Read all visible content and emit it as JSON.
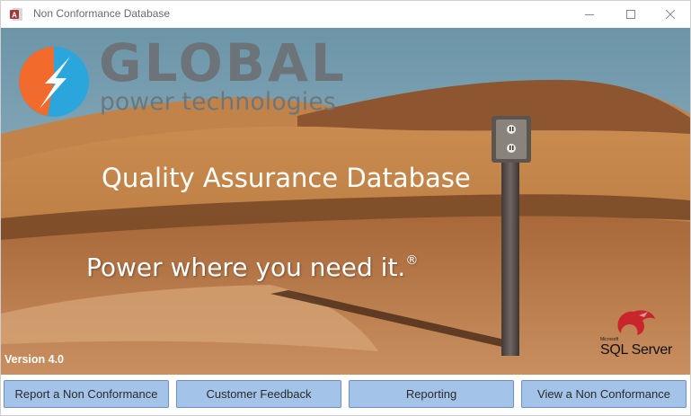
{
  "window": {
    "title": "Non Conformance Database",
    "app_icon": "access-icon",
    "controls": [
      "minimize-icon",
      "maximize-icon",
      "close-icon"
    ]
  },
  "splash": {
    "logo": {
      "word": "GLOBAL",
      "subword": "power technologies",
      "icon": "lightning-bolt-icon"
    },
    "title": "Quality Assurance Database",
    "tagline": "Power where you need it.",
    "tagline_mark": "®",
    "version": "Version 4.0",
    "sql_logo": {
      "word": "SQL Server",
      "micro": "Microsoft"
    }
  },
  "buttons": {
    "report": "Report a Non Conformance",
    "feedback": "Customer Feedback",
    "reporting": "Reporting",
    "view": "View a Non Conformance"
  },
  "colors": {
    "button_fill": "#a3c3e8",
    "button_border": "#6d8fb8",
    "logo_orange": "#f26a2c",
    "logo_blue": "#2aa6dd",
    "logo_grey": "#6c7479",
    "sky": "#7fa3b4",
    "sand": "#b0703a"
  }
}
